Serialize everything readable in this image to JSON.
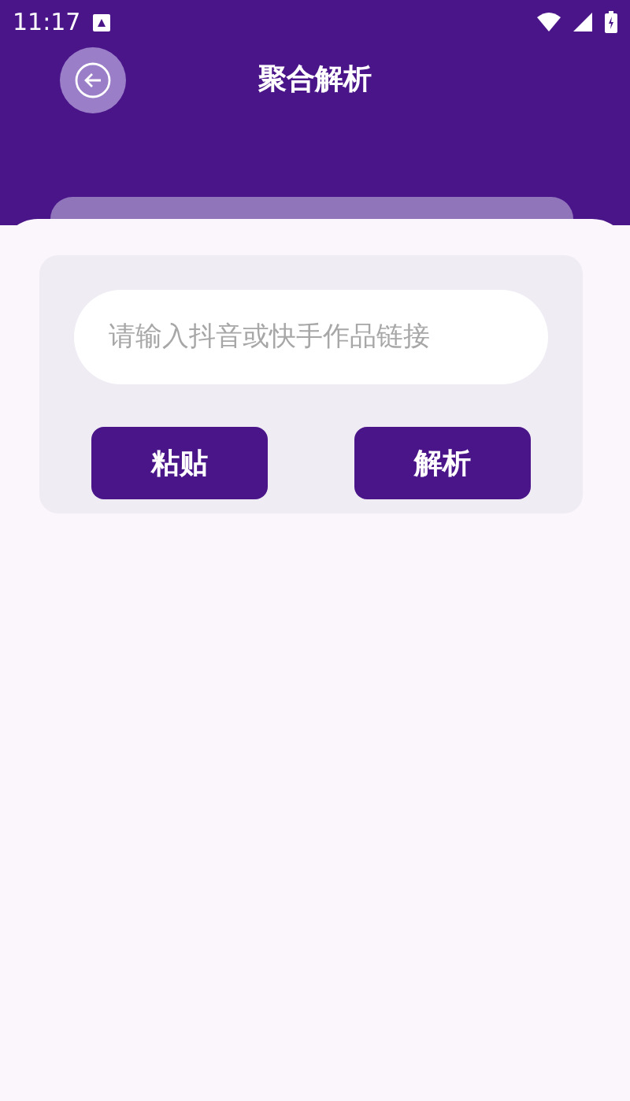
{
  "status_bar": {
    "time": "11:17"
  },
  "header": {
    "title": "聚合解析"
  },
  "input": {
    "placeholder": "请输入抖音或快手作品链接"
  },
  "buttons": [
    {
      "label": "粘贴"
    },
    {
      "label": "解析"
    }
  ]
}
